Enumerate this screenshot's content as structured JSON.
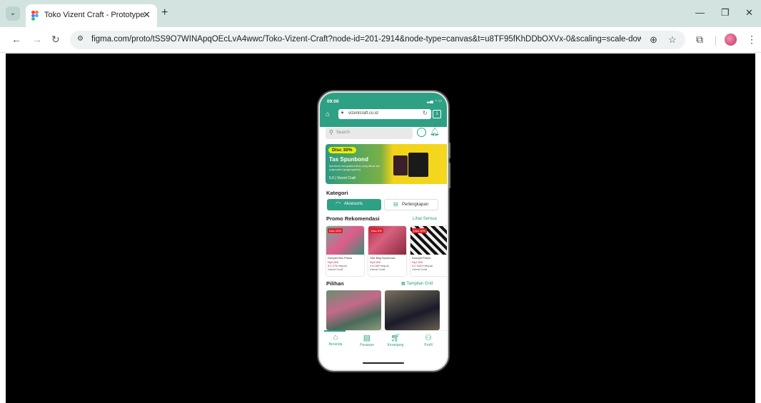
{
  "browser": {
    "tab_title": "Toko Vizent Craft - Prototype",
    "url": "figma.com/proto/tSS9O7WINApqOEcLvA4wwc/Toko-Vizent-Craft?node-id=201-2914&node-type=canvas&t=u8TF95fKhDDbOXVx-0&scaling=scale-down&co..."
  },
  "phone": {
    "status": {
      "time": "09:00"
    },
    "url_bar": {
      "domain": "vizentcraft.co.id",
      "tab_count": "1"
    },
    "search": {
      "placeholder": "Search"
    },
    "banner": {
      "badge": "Disc 30%",
      "title": "Tas Spunbond",
      "description": "Spunbond merupakan bahan yang dibuat dari polypropilen (polypropylene)",
      "rating": "5.0 | Vizent Craft"
    },
    "kategori": {
      "title": "Kategori",
      "items": [
        "Aksesoris",
        "Perlengkapan"
      ]
    },
    "promo": {
      "title": "Promo Rekomendasi",
      "see_all": "Lihat Semua",
      "products": [
        {
          "badge": "Disc 10%",
          "name": "Dompet Box Prada",
          "price": "Rp5.800",
          "rating": "5.0 275+terjual",
          "store": "Vizent Craft"
        },
        {
          "badge": "Disc 5%",
          "name": "Tote Bag Spunbond...",
          "price": "Rp3.500",
          "rating": "4.8 180+terjual",
          "store": "Vizent Craft"
        },
        {
          "badge": "Disc 10%",
          "name": "Dompet Pouch",
          "price": "Rp2.500",
          "rating": "5.0 3420+terjual",
          "store": "Vizent Craft"
        }
      ]
    },
    "pilihan": {
      "title": "Pilihan",
      "view_toggle": "Tampilan Grid"
    },
    "bottom_nav": {
      "items": [
        "Beranda",
        "Pesanan",
        "Keranjang",
        "Profil"
      ]
    }
  },
  "colors": {
    "brand": "#2ea083",
    "canvas": "#000000",
    "banner_yellow": "#f2d21a",
    "discount_red": "#e0202a"
  }
}
